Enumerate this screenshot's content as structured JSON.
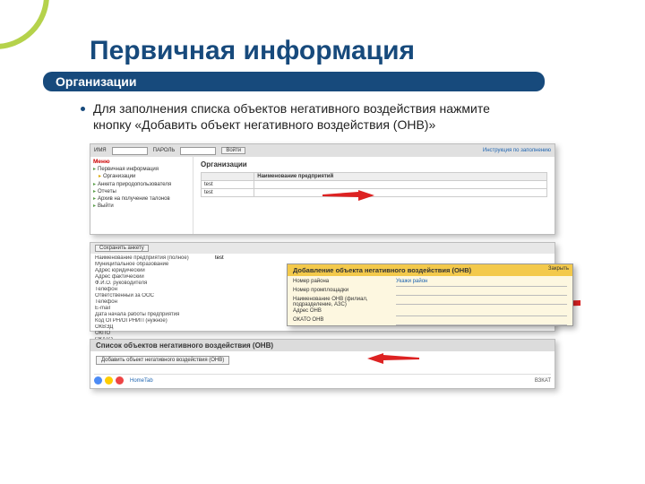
{
  "title": "Первичная информация",
  "section": "Организации",
  "body": "Для заполнения списка объектов негативного воздействия нажмите кнопку «Добавить объект негативного воздействия (ОНВ)»",
  "login": {
    "user_label": "ИМЯ",
    "pass_label": "ПАРОЛЬ",
    "enter": "Войти",
    "hint": "Инструкция по заполнению"
  },
  "menu": {
    "header": "Меню",
    "items": [
      "Первичная информация",
      "Организации",
      "Анкета природопользователя",
      "Отчеты",
      "Архив на получение талонов",
      "Выйти"
    ]
  },
  "org_panel": {
    "heading": "Организации",
    "cols": [
      "",
      "Наименование предприятий"
    ],
    "rows": [
      [
        "test",
        ""
      ],
      [
        "test",
        ""
      ]
    ]
  },
  "form": {
    "save": "Сохранить анкету",
    "fields": [
      "Наименование предприятия (полное)",
      "Муниципальное образование",
      "Адрес юридический",
      "Адрес фактический",
      "Ф.И.О. руководителя",
      "Телефон",
      "Ответственный за ООС",
      "Телефон",
      "E-mail",
      "Дата начала работы предприятия",
      "Код ОГРН/ОГРНИП (нужное)",
      "ОКВЭД",
      "ОКПО",
      "ОКАТО"
    ],
    "values": [
      "test",
      "",
      "",
      "",
      "",
      "",
      "",
      "",
      "",
      "",
      "",
      "",
      "",
      ""
    ]
  },
  "list_panel": {
    "title": "Список объектов негативного воздействия (ОНВ)",
    "add": "Добавить объект негативного воздействия (ОНВ)"
  },
  "dialog": {
    "title": "Добавление объекта негативного воздействия (ОНВ)",
    "close": "Закрыть",
    "fields": [
      "Номер района",
      "Номер промплощадки",
      "Наименование ОНВ (филиал, подразделение, АЗС)",
      "Адрес ОНВ",
      "ОКАТО ОНВ"
    ],
    "hints": [
      "Укажи район",
      "",
      "",
      "",
      ""
    ]
  },
  "taskbar": {
    "label": "HomeTab",
    "right": "ВЗКАТ"
  }
}
